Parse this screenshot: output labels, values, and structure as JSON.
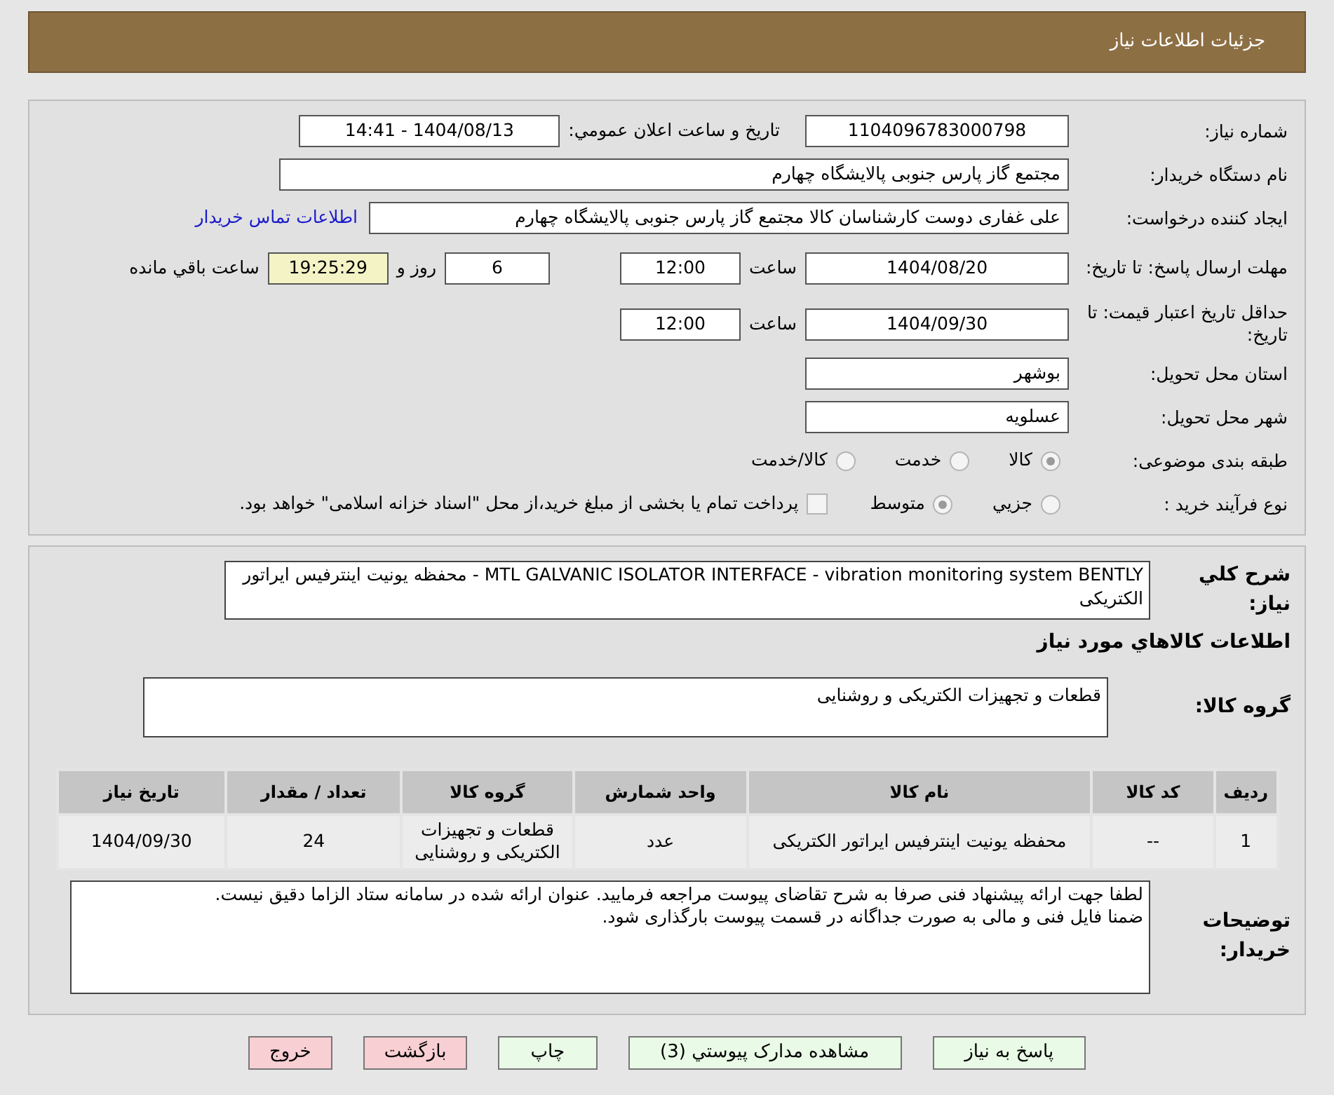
{
  "header": {
    "title": "جزئیات اطلاعات نیاز"
  },
  "need_info": {
    "need_number": {
      "label": "شماره نیاز:",
      "value": "1104096783000798"
    },
    "announce": {
      "label": "تاریخ و ساعت اعلان عمومي:",
      "value": "1404/08/13 - 14:41"
    },
    "buyer": {
      "label": "نام دستگاه خریدار:",
      "value": "مجتمع گاز پارس جنوبی  پالایشگاه چهارم"
    },
    "creator": {
      "label": "ایجاد کننده درخواست:",
      "value": "علی غفاری دوست کارشناسان کالا مجتمع گاز پارس جنوبی  پالایشگاه چهارم",
      "link": "اطلاعات تماس خریدار"
    },
    "deadline": {
      "label": "مهلت ارسال پاسخ: تا تاریخ:",
      "date": "1404/08/20",
      "time_label": "ساعت",
      "time": "12:00",
      "days": "6",
      "days_label": "روز و",
      "remaining": "19:25:29",
      "remaining_label": "ساعت باقي مانده"
    },
    "validity": {
      "label": "حداقل تاریخ اعتبار قیمت: تا تاریخ:",
      "date": "1404/09/30",
      "time_label": "ساعت",
      "time": "12:00"
    },
    "province": {
      "label": "استان محل تحویل:",
      "value": "بوشهر"
    },
    "city": {
      "label": "شهر محل تحویل:",
      "value": "عسلویه"
    },
    "category": {
      "label": "طبقه بندی موضوعی:",
      "options": [
        {
          "label": "کالا",
          "selected": true
        },
        {
          "label": "خدمت",
          "selected": false
        },
        {
          "label": "کالا/خدمت",
          "selected": false
        }
      ]
    },
    "process": {
      "label": "نوع فرآیند خرید :",
      "options": [
        {
          "label": "جزيي",
          "selected": false
        },
        {
          "label": "متوسط",
          "selected": true
        }
      ],
      "treasury": {
        "checked": false,
        "label": "پرداخت تمام یا بخشی از مبلغ خرید،از محل \"اسناد خزانه اسلامی\" خواهد بود."
      }
    }
  },
  "details": {
    "summary": {
      "label": "شرح کلي نیاز:",
      "value": "MTL  GALVANIC ISOLATOR INTERFACE  -  vibration monitoring system BENTLY -      محفظه یونیت اینترفیس ایراتور الکتریکی"
    },
    "goods_heading": "اطلاعات کالاهاي مورد نیاز",
    "goods_group": {
      "label": "گروه کالا:",
      "value": "قطعات و تجهیزات الکتریکی و روشنایی"
    },
    "table": {
      "columns": [
        "ردیف",
        "کد کالا",
        "نام کالا",
        "واحد شمارش",
        "گروه کالا",
        "تعداد / مقدار",
        "تاریخ نیاز"
      ],
      "rows": [
        [
          "1",
          "--",
          "محفظه یونیت اینترفیس ایراتور الکتریکی",
          "عدد",
          "قطعات و تجهیزات الکتریکی و روشنایی",
          "24",
          "1404/09/30"
        ]
      ]
    },
    "buyer_notes": {
      "label": "توضیحات خریدار:",
      "lines": [
        "لطفا جهت ارائه پیشنهاد فنی صرفا به شرح تقاضای پیوست مراجعه فرمایید. عنوان ارائه شده در سامانه ستاد الزاما دقیق نیست.",
        "ضمنا فایل فنی و مالی به صورت جداگانه در قسمت پیوست بارگذاری شود."
      ]
    }
  },
  "buttons": [
    {
      "label": "پاسخ به نیاز",
      "kind": "positive"
    },
    {
      "label": "مشاهده مدارک پیوستي (3)",
      "kind": "positive"
    },
    {
      "label": "چاپ",
      "kind": "positive"
    },
    {
      "label": "بازگشت",
      "kind": "negative"
    },
    {
      "label": "خروج",
      "kind": "negative"
    }
  ]
}
